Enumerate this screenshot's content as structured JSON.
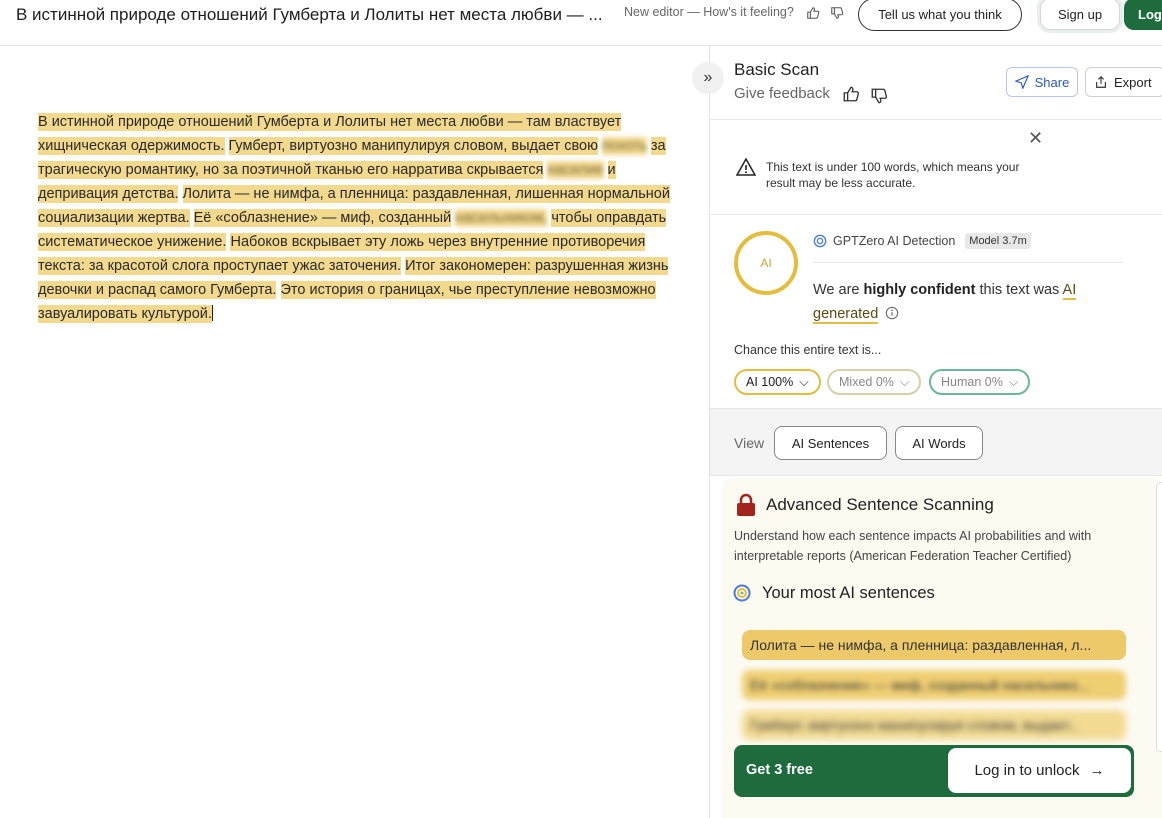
{
  "header": {
    "doc_title": "В истинной природе отношений Гумберта и Лолиты нет места любви — ...",
    "editor_note": "New editor — How's it feeling?",
    "feedback_button": "Tell us what you think",
    "signup": "Sign up",
    "login": "Log"
  },
  "editor": {
    "segments": [
      "В истинной природе отношений Гумберта и Лолиты нет места любви — там властвует хищническая одержимость.",
      "Гумберт, виртуозно манипулируя словом, выдает свою",
      "за трагическую романтику, но за поэтичной тканью его нарратива скрывается",
      "и депривация детства.",
      "Лолита — не нимфа, а пленница: раздавленная, лишенная нормальной социализации жертва.",
      "Её «соблазнение» — миф, созданный",
      "чтобы оправдать систематическое унижение.",
      "Набоков вскрывает эту ложь через внутренние противоречия текста: за красотой слога проступает ужас заточения.",
      "Итог закономерен: разрушенная жизнь девочки и распад самого Гумберта.",
      "Это история о границах, чье преступление невозможно завуалировать культурой."
    ],
    "blurred": [
      "похоть",
      "насилие",
      "насильником,"
    ]
  },
  "panel": {
    "title": "Basic Scan",
    "give_feedback": "Give feedback",
    "share": "Share",
    "export": "Export",
    "warning": "This text is under 100 words, which means your result may be less accurate.",
    "ai_ring_label": "AI",
    "detector_name": "GPTZero AI Detection",
    "model": "Model 3.7m",
    "confidence_pre": "We are ",
    "confidence_bold": "highly confident",
    "confidence_mid": " this text was ",
    "confidence_ai": "AI",
    "confidence_gen": "generated",
    "chance_label": "Chance this entire text is...",
    "chips": {
      "ai": "AI 100%",
      "mixed": "Mixed 0%",
      "human": "Human 0%"
    },
    "view_label": "View",
    "view_ai_sentences": "AI Sentences",
    "view_ai_words": "AI Words",
    "advanced_title": "Advanced Sentence Scanning",
    "advanced_desc": "Understand how each sentence impacts AI probabilities and with interpretable reports (American Federation Teacher Certified)",
    "most_title": "Your most AI sentences",
    "sentences": [
      "Лолита — не нимфа, а пленница: раздавленная, л...",
      "Её «соблазнение» — миф, созданный насильнико...",
      "Гумберт, виртуозно манипулируя словом, выдает..."
    ],
    "get_free": "Get 3 free",
    "login_unlock": "Log in to unlock"
  },
  "colors": {
    "highlight": "#f3d98e",
    "ai_ring": "#e3be3e",
    "green": "#1e6b3e",
    "human": "#6cb99a"
  }
}
